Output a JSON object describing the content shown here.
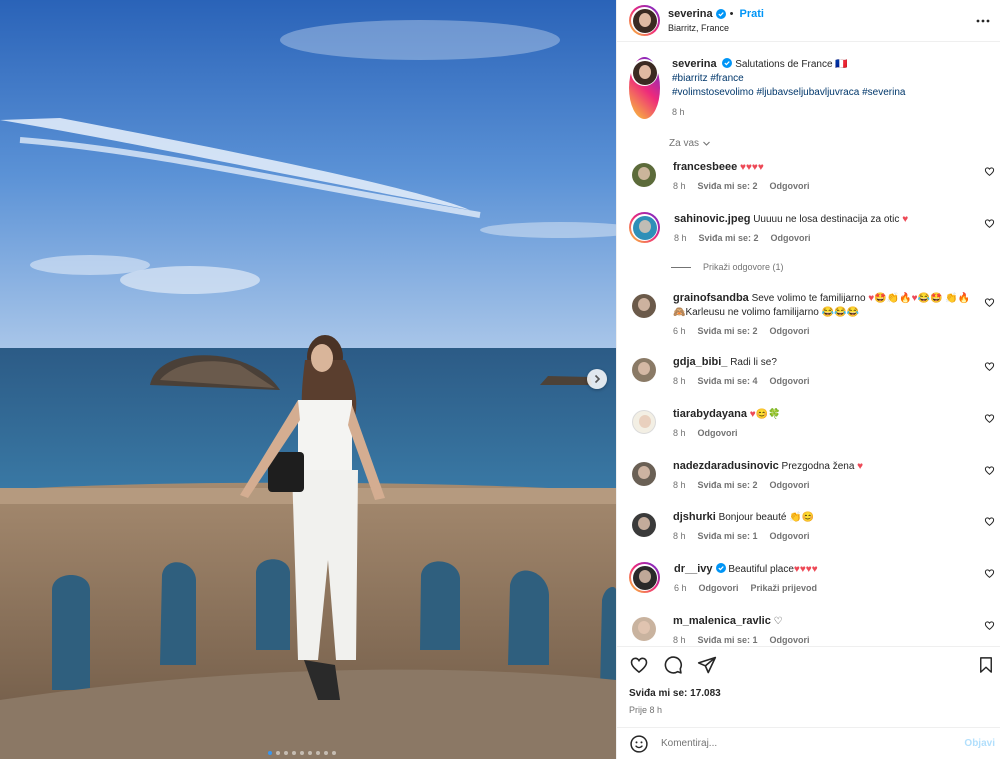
{
  "header": {
    "username": "severina",
    "follow_label": "Prati",
    "location": "Biarritz, France"
  },
  "caption": {
    "username": "severina",
    "text": "Salutations de France 🇫🇷",
    "hashtags_line1": "#biarritz #france",
    "hashtags_line2": "#volimstosevolimo #ljubavseljubavljuvraca #severina",
    "time": "8 h"
  },
  "filter_label": "Za vas",
  "show_replies_label": "Prikaži odgovore (1)",
  "comments": [
    {
      "username": "francesbeee",
      "text": "♥♥♥♥",
      "time": "8 h",
      "likes": "Sviđa mi se: 2",
      "reply": "Odgovori",
      "extra": ""
    },
    {
      "username": "sahinovic.jpeg",
      "text": "Uuuuu ne losa destinacija za otic ♥",
      "time": "8 h",
      "likes": "Sviđa mi se: 2",
      "reply": "Odgovori",
      "extra": ""
    },
    {
      "username": "grainofsandba",
      "text": "Seve volimo te familijarno ♥🤩👏🔥♥😂🤩 👏🔥🙈Karleusu ne volimo familijarno 😂😂😂",
      "time": "6 h",
      "likes": "Sviđa mi se: 2",
      "reply": "Odgovori",
      "extra": ""
    },
    {
      "username": "gdja_bibi_",
      "text": "Radi li se?",
      "time": "8 h",
      "likes": "Sviđa mi se: 4",
      "reply": "Odgovori",
      "extra": ""
    },
    {
      "username": "tiarabydayana",
      "text": "♥😊🍀",
      "time": "8 h",
      "likes": "",
      "reply": "Odgovori",
      "extra": ""
    },
    {
      "username": "nadezdaradusinovic",
      "text": "Prezgodna žena ♥",
      "time": "8 h",
      "likes": "Sviđa mi se: 2",
      "reply": "Odgovori",
      "extra": ""
    },
    {
      "username": "djshurki",
      "text": "Bonjour beauté 👏😊",
      "time": "8 h",
      "likes": "Sviđa mi se: 1",
      "reply": "Odgovori",
      "extra": ""
    },
    {
      "username": "dr__ivy",
      "text": "Beautiful place♥♥♥♥",
      "time": "6 h",
      "likes": "",
      "reply": "Odgovori",
      "extra": "Prikaži prijevod"
    },
    {
      "username": "m_malenica_ravlic",
      "text": "♡",
      "time": "8 h",
      "likes": "Sviđa mi se: 1",
      "reply": "Odgovori",
      "extra": ""
    }
  ],
  "likes_count": "Sviđa mi se: 17.083",
  "posted_ago": "Prije 8 h",
  "comment_input": {
    "placeholder": "Komentiraj..."
  },
  "post_label": "Objavi",
  "carousel": {
    "total": 9,
    "active": 1
  },
  "colors": {
    "accent": "#0095f6",
    "heart": "#ed4956",
    "verified": "#0095f6"
  }
}
